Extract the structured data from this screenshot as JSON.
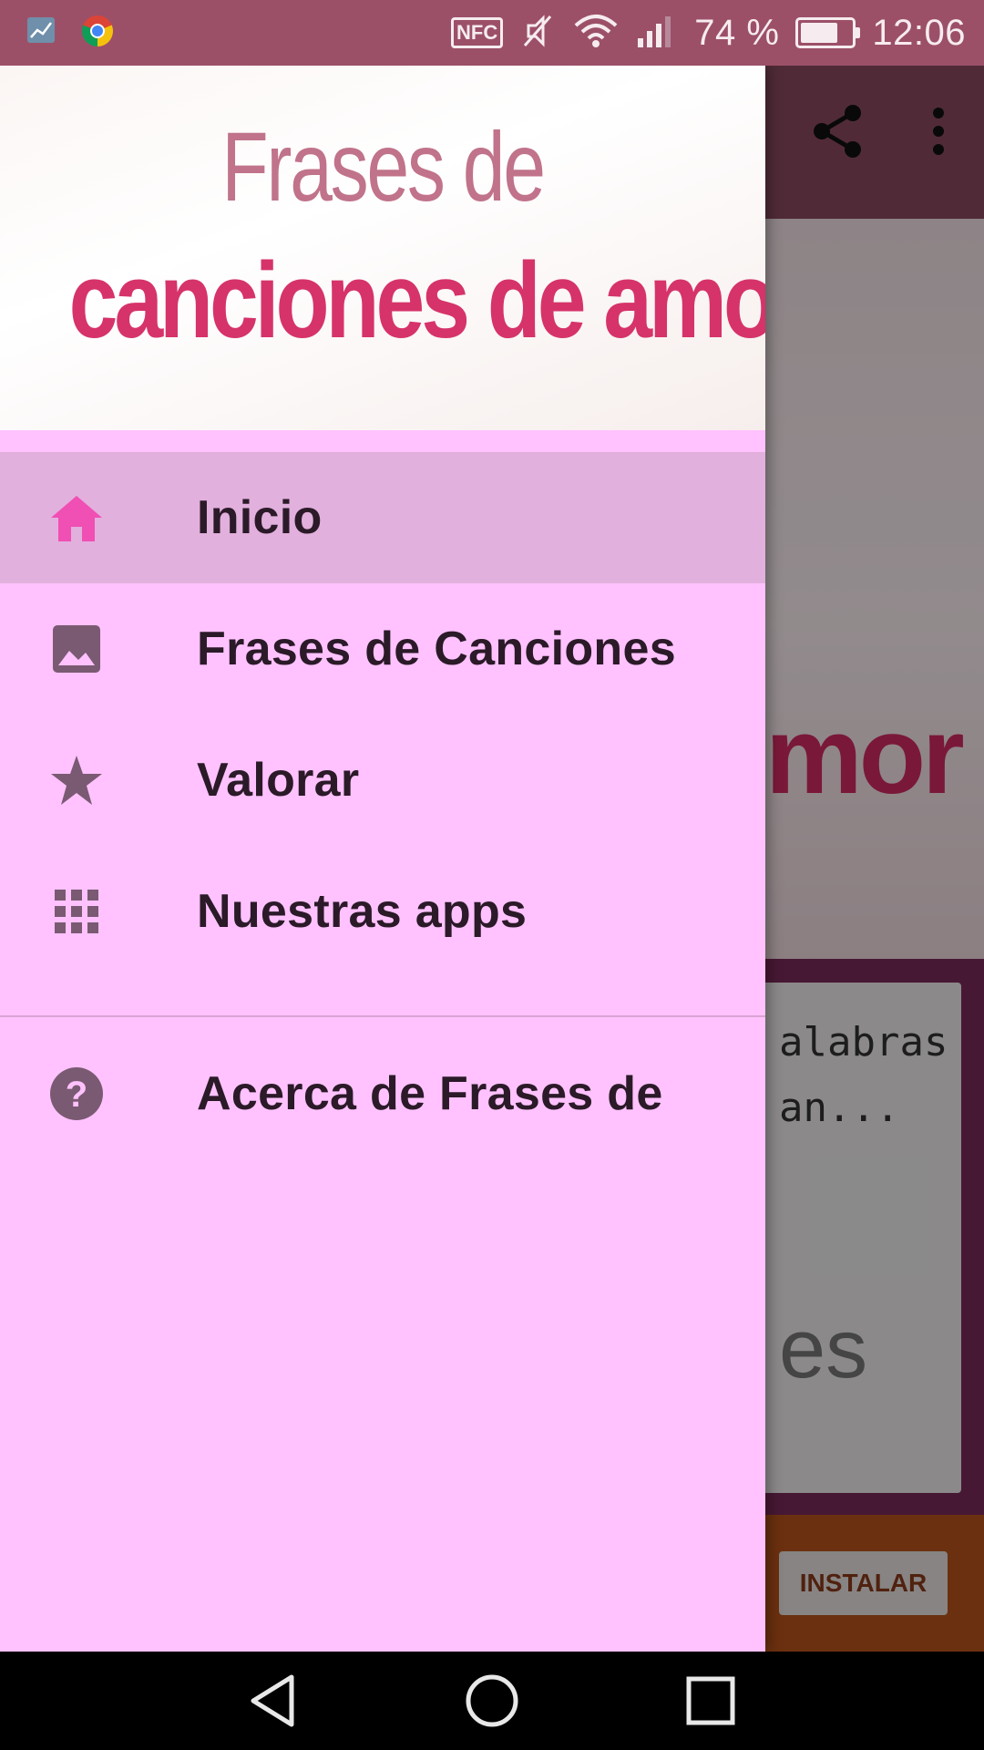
{
  "status_bar": {
    "battery_text": "74 %",
    "battery_level": 0.74,
    "time": "12:06",
    "nfc_label": "NFC",
    "icons": [
      "stats-app-icon",
      "chrome-icon",
      "nfc-icon",
      "mute-icon",
      "wifi-icon",
      "signal-icon",
      "battery-icon"
    ]
  },
  "drawer": {
    "header_line1": "Frases de",
    "header_line2": "canciones de amor",
    "items": [
      {
        "label": "Inicio",
        "icon": "home-icon",
        "active": true
      },
      {
        "label": "Frases de Canciones",
        "icon": "image-icon",
        "active": false
      },
      {
        "label": "Valorar",
        "icon": "star-icon",
        "active": false
      },
      {
        "label": "Nuestras apps",
        "icon": "apps-grid-icon",
        "active": false
      }
    ],
    "secondary_items": [
      {
        "label": "Acerca de Frases de",
        "icon": "help-icon"
      }
    ]
  },
  "background_app": {
    "toolbar_icons": [
      "share-icon",
      "overflow-menu-icon"
    ],
    "banner_text": "mor",
    "card_text_line1": "alabras",
    "card_text_line2": "an...",
    "card_big_text": "es",
    "ad_button_label": "INSTALAR"
  },
  "nav_bar": {
    "buttons": [
      "back-icon",
      "home-circle-icon",
      "recents-icon"
    ]
  },
  "colors": {
    "status_bar": "#9c5068",
    "drawer_bg": "#ffc2fe",
    "active_item_bg": "#e2b0dd",
    "active_icon": "#f04fb4",
    "inactive_icon": "#7a5a72",
    "header_pink": "#d6336a"
  }
}
